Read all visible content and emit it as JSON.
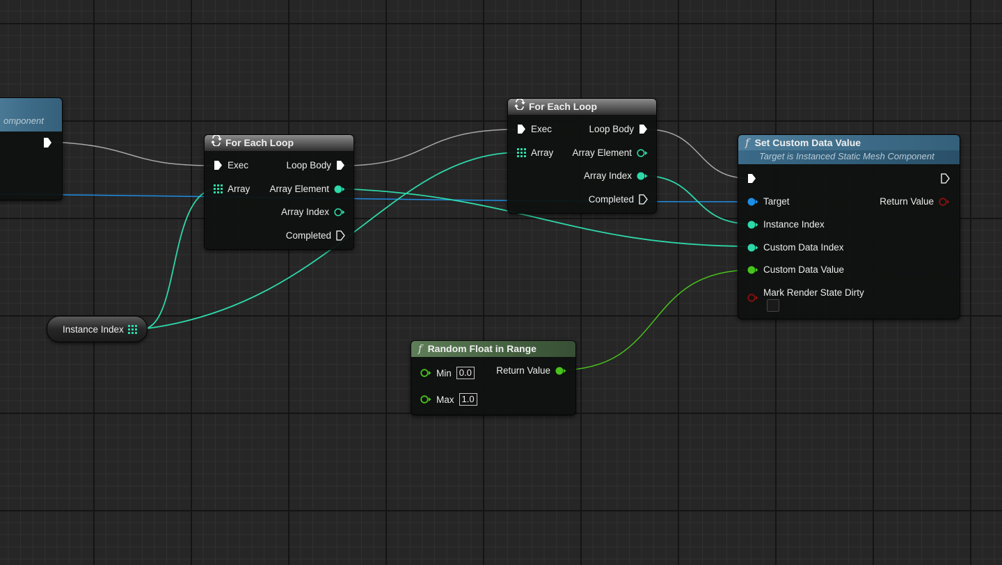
{
  "colors": {
    "exec": "#ffffff",
    "integer": "#2ed8a9",
    "object": "#1e8fe6",
    "float": "#48c31d",
    "bool": "#8b0f0f",
    "exec_wire": "#b0b0b0"
  },
  "left_node": {
    "subtitle_fragment": "omponent"
  },
  "loop1": {
    "title": "For Each Loop",
    "icon": "loop-icon",
    "exec": "Exec",
    "array": "Array",
    "loop_body": "Loop Body",
    "array_element": "Array Element",
    "array_index": "Array Index",
    "completed": "Completed"
  },
  "loop2": {
    "title": "For Each Loop",
    "icon": "loop-icon",
    "exec": "Exec",
    "array": "Array",
    "loop_body": "Loop Body",
    "array_element": "Array Element",
    "array_index": "Array Index",
    "completed": "Completed"
  },
  "set_node": {
    "icon": "function-icon",
    "title": "Set Custom Data Value",
    "subtitle": "Target is Instanced Static Mesh Component",
    "target": "Target",
    "return_value": "Return Value",
    "instance_index": "Instance Index",
    "custom_data_index": "Custom Data Index",
    "custom_data_value": "Custom Data Value",
    "mark_render_state_dirty": "Mark Render State Dirty",
    "mark_render_state_dirty_checked": false
  },
  "random_node": {
    "icon": "function-icon",
    "title": "Random Float in Range",
    "min_label": "Min",
    "min_value": "0.0",
    "max_label": "Max",
    "max_value": "1.0",
    "return_value": "Return Value"
  },
  "instance_var": {
    "label": "Instance Index",
    "icon": "array-icon"
  }
}
